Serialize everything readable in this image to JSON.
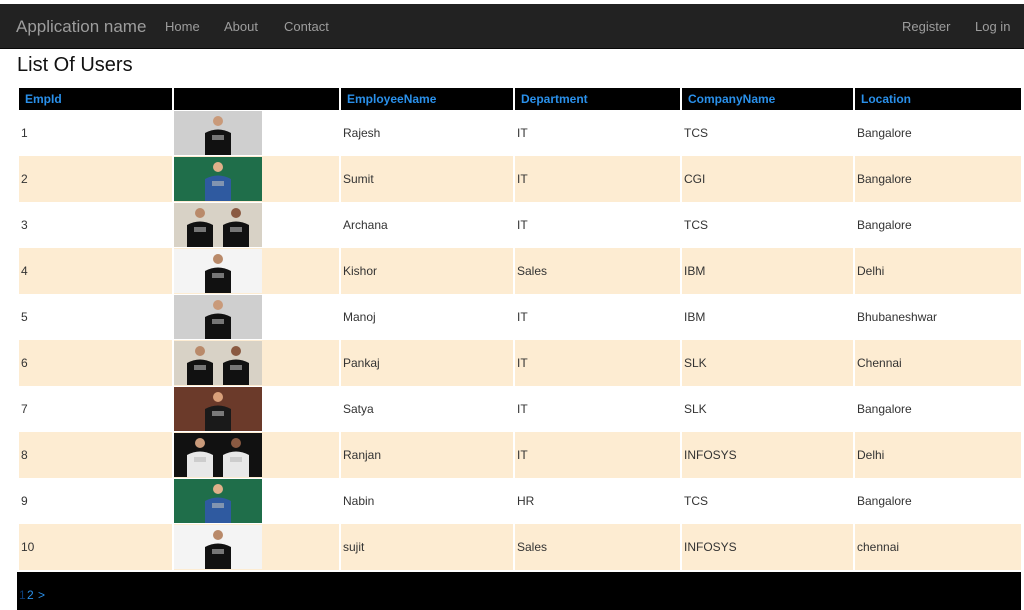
{
  "navbar": {
    "brand": "Application name",
    "links": [
      "Home",
      "About",
      "Contact"
    ],
    "right_links": [
      "Register",
      "Log in"
    ]
  },
  "page": {
    "title": "List Of Users"
  },
  "table": {
    "columns": [
      "EmpId",
      "",
      "EmployeeName",
      "Department",
      "CompanyName",
      "Location"
    ],
    "rows": [
      {
        "id": "1",
        "name": "Rajesh",
        "department": "IT",
        "company": "TCS",
        "location": "Bangalore",
        "photo": "person-black-tshirt-photo"
      },
      {
        "id": "2",
        "name": "Sumit",
        "department": "IT",
        "company": "CGI",
        "location": "Bangalore",
        "photo": "person-green-background-photo"
      },
      {
        "id": "3",
        "name": "Archana",
        "department": "IT",
        "company": "TCS",
        "location": "Bangalore",
        "photo": "couple-black-tshirts-photo"
      },
      {
        "id": "4",
        "name": "Kishor",
        "department": "Sales",
        "company": "IBM",
        "location": "Delhi",
        "photo": "person-black-tshirt-white-bg-photo"
      },
      {
        "id": "5",
        "name": "Manoj",
        "department": "IT",
        "company": "IBM",
        "location": "Bhubaneshwar",
        "photo": "person-black-tshirt-photo"
      },
      {
        "id": "6",
        "name": "Pankaj",
        "department": "IT",
        "company": "SLK",
        "location": "Chennai",
        "photo": "couple-black-tshirts-photo"
      },
      {
        "id": "7",
        "name": "Satya",
        "department": "IT",
        "company": "SLK",
        "location": "Bangalore",
        "photo": "person-dark-tshirt-photo"
      },
      {
        "id": "8",
        "name": "Ranjan",
        "department": "IT",
        "company": "INFOSYS",
        "location": "Delhi",
        "photo": "couple-white-tshirts-photo"
      },
      {
        "id": "9",
        "name": "Nabin",
        "department": "HR",
        "company": "TCS",
        "location": "Bangalore",
        "photo": "person-green-background-photo"
      },
      {
        "id": "10",
        "name": "sujit",
        "department": "Sales",
        "company": "INFOSYS",
        "location": "chennai",
        "photo": "person-black-tshirt-white-bg-photo"
      }
    ]
  },
  "pager": {
    "current": "1",
    "pages": [
      "2"
    ],
    "next": ">"
  },
  "colors": {
    "navbar_bg": "#222222",
    "header_bg": "#000000",
    "header_text": "#2a90ea",
    "row_alt_bg": "#fdecd2",
    "pager_bg": "#000000"
  }
}
